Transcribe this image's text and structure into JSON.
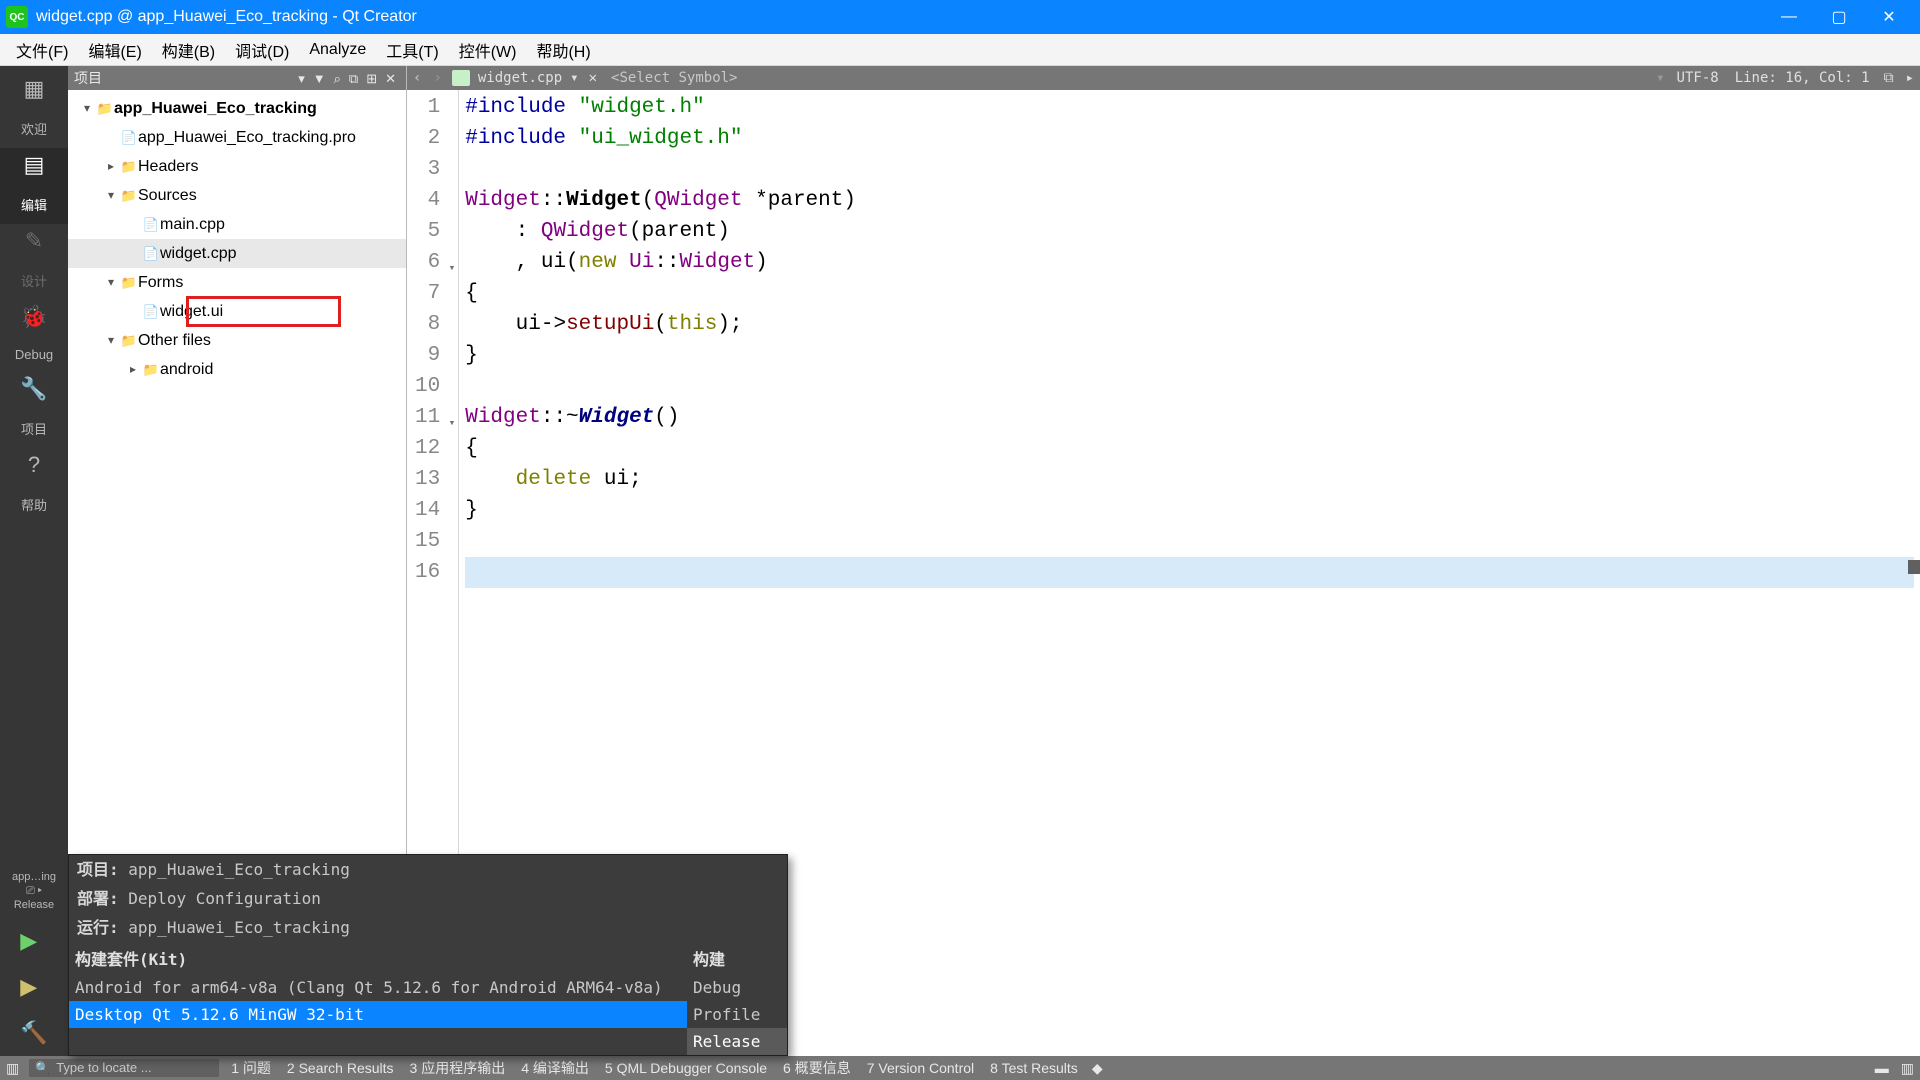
{
  "titlebar": {
    "icon": "QC",
    "text": "widget.cpp @ app_Huawei_Eco_tracking - Qt Creator"
  },
  "menubar": [
    "文件(F)",
    "编辑(E)",
    "构建(B)",
    "调试(D)",
    "Analyze",
    "工具(T)",
    "控件(W)",
    "帮助(H)"
  ],
  "sidebar": [
    {
      "icon": "▦",
      "label": "欢迎",
      "key": "welcome"
    },
    {
      "icon": "▤",
      "label": "编辑",
      "key": "edit",
      "active": true
    },
    {
      "icon": "✎",
      "label": "设计",
      "key": "design",
      "inactive": true
    },
    {
      "icon": "🐞",
      "label": "Debug",
      "key": "debug"
    },
    {
      "icon": "🔧",
      "label": "项目",
      "key": "projects"
    },
    {
      "icon": "?",
      "label": "帮助",
      "key": "help"
    }
  ],
  "kitinfo": {
    "line1": "app…ing",
    "line2": "⎚ ▸",
    "line3": "Release"
  },
  "runbuttons": [
    {
      "glyph": "▶",
      "key": "run",
      "cls": ""
    },
    {
      "glyph": "▶",
      "key": "run-debug",
      "cls": "yellow"
    },
    {
      "glyph": "🔨",
      "key": "build",
      "cls": "hammer"
    }
  ],
  "treepane": {
    "header_label": "项目",
    "header_icons": [
      "▾",
      "▼",
      "⌕",
      "⧉",
      "⊞",
      "✕"
    ]
  },
  "tree": [
    {
      "level": 1,
      "arrow": "▾",
      "icon": "📁",
      "label": "app_Huawei_Eco_tracking",
      "bold": true
    },
    {
      "level": 2,
      "arrow": "",
      "icon": "📄",
      "label": "app_Huawei_Eco_tracking.pro"
    },
    {
      "level": 2,
      "arrow": "▸",
      "icon": "📁",
      "label": "Headers"
    },
    {
      "level": 2,
      "arrow": "▾",
      "icon": "📁",
      "label": "Sources"
    },
    {
      "level": 3,
      "arrow": "",
      "icon": "📄",
      "label": "main.cpp"
    },
    {
      "level": 3,
      "arrow": "",
      "icon": "📄",
      "label": "widget.cpp",
      "selected": true
    },
    {
      "level": 2,
      "arrow": "▾",
      "icon": "📁",
      "label": "Forms"
    },
    {
      "level": 3,
      "arrow": "",
      "icon": "📄",
      "label": "widget.ui",
      "redbox": true
    },
    {
      "level": 2,
      "arrow": "▾",
      "icon": "📁",
      "label": "Other files"
    },
    {
      "level": 3,
      "arrow": "▸",
      "icon": "📁",
      "label": "android"
    }
  ],
  "editor": {
    "file": "widget.cpp",
    "symbol": "<Select Symbol>",
    "encoding": "UTF-8",
    "status_line": "Line: 16, Col: 1",
    "lines": 16,
    "folds": [
      6,
      11
    ],
    "current_line": 16,
    "code": [
      [
        [
          "pp",
          "#include"
        ],
        [
          "sp",
          " "
        ],
        [
          "str",
          "\"widget.h\""
        ]
      ],
      [
        [
          "pp",
          "#include"
        ],
        [
          "sp",
          " "
        ],
        [
          "str",
          "\"ui_widget.h\""
        ]
      ],
      [],
      [
        [
          "type",
          "Widget"
        ],
        [
          "op",
          "::"
        ],
        [
          "fn",
          "Widget"
        ],
        [
          "op",
          "("
        ],
        [
          "type",
          "QWidget"
        ],
        [
          "sp",
          " *"
        ],
        [
          "id",
          "parent"
        ],
        [
          "op",
          ")"
        ]
      ],
      [
        [
          "sp",
          "    : "
        ],
        [
          "type",
          "QWidget"
        ],
        [
          "op",
          "("
        ],
        [
          "id",
          "parent"
        ],
        [
          "op",
          ")"
        ]
      ],
      [
        [
          "sp",
          "    , "
        ],
        [
          "id",
          "ui"
        ],
        [
          "op",
          "("
        ],
        [
          "keyword",
          "new"
        ],
        [
          "sp",
          " "
        ],
        [
          "type",
          "Ui"
        ],
        [
          "op",
          "::"
        ],
        [
          "type",
          "Widget"
        ],
        [
          "op",
          ")"
        ]
      ],
      [
        [
          "op",
          "{"
        ]
      ],
      [
        [
          "sp",
          "    "
        ],
        [
          "id",
          "ui"
        ],
        [
          "op",
          "->"
        ],
        [
          "member",
          "setupUi"
        ],
        [
          "op",
          "("
        ],
        [
          "this",
          "this"
        ],
        [
          "op",
          ");"
        ]
      ],
      [
        [
          "op",
          "}"
        ]
      ],
      [],
      [
        [
          "type",
          "Widget"
        ],
        [
          "op",
          "::~"
        ],
        [
          "dtor",
          "Widget"
        ],
        [
          "op",
          "()"
        ]
      ],
      [
        [
          "op",
          "{"
        ]
      ],
      [
        [
          "sp",
          "    "
        ],
        [
          "keyword",
          "delete"
        ],
        [
          "sp",
          " "
        ],
        [
          "id",
          "ui"
        ],
        [
          "op",
          ";"
        ]
      ],
      [
        [
          "op",
          "}"
        ]
      ],
      [],
      []
    ]
  },
  "kitpopup": {
    "rows": [
      {
        "label": "项目",
        "value": "app_Huawei_Eco_tracking"
      },
      {
        "label": "部署",
        "value": "Deploy Configuration"
      },
      {
        "label": "运行",
        "value": "app_Huawei_Eco_tracking"
      }
    ],
    "kit_header": "构建套件(Kit)",
    "build_header": "构建",
    "kits": [
      {
        "name": "Android for arm64-v8a (Clang Qt 5.12.6 for Android ARM64-v8a)",
        "selected": false
      },
      {
        "name": "Desktop Qt 5.12.6 MinGW 32-bit",
        "selected": true
      }
    ],
    "builds": [
      {
        "name": "Debug",
        "selected": false
      },
      {
        "name": "Profile",
        "selected": false
      },
      {
        "name": "Release",
        "selected": true
      }
    ]
  },
  "bottombar": {
    "search_placeholder": "Type to locate ...",
    "tabs": [
      "1 问题",
      "2 Search Results",
      "3 应用程序输出",
      "4 编译输出",
      "5 QML Debugger Console",
      "6 概要信息",
      "7 Version Control",
      "8 Test Results"
    ]
  }
}
